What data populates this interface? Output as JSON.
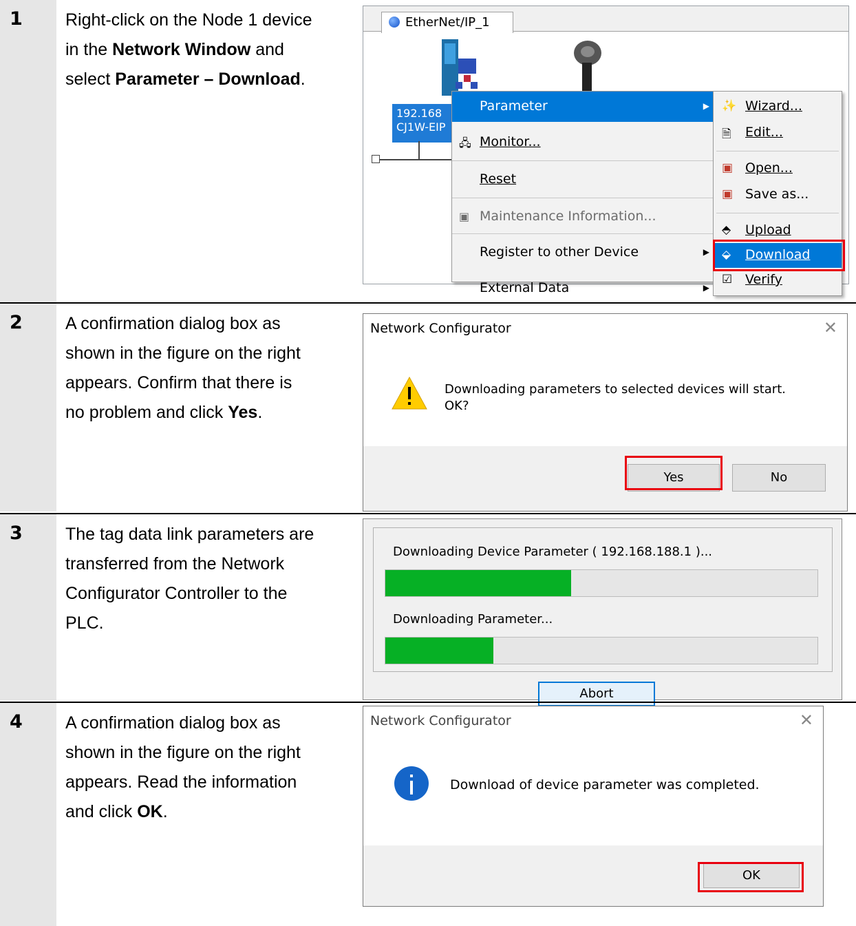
{
  "steps": [
    {
      "number": "1",
      "lines": [
        [
          {
            "t": "Right-click on the Node 1 device",
            "b": false
          }
        ],
        [
          {
            "t": "in the ",
            "b": false
          },
          {
            "t": "Network Window",
            "b": true
          },
          {
            "t": " and",
            "b": false
          }
        ],
        [
          {
            "t": "select ",
            "b": false
          },
          {
            "t": "Parameter – Download",
            "b": true
          },
          {
            "t": ".",
            "b": false
          }
        ]
      ]
    },
    {
      "number": "2",
      "lines": [
        [
          {
            "t": "A confirmation dialog box as",
            "b": false
          }
        ],
        [
          {
            "t": "shown in the figure on the right",
            "b": false
          }
        ],
        [
          {
            "t": "appears. Confirm that there is",
            "b": false
          }
        ],
        [
          {
            "t": "no problem and click ",
            "b": false
          },
          {
            "t": "Yes",
            "b": true
          },
          {
            "t": ".",
            "b": false
          }
        ]
      ]
    },
    {
      "number": "3",
      "lines": [
        [
          {
            "t": "The tag data link parameters are",
            "b": false
          }
        ],
        [
          {
            "t": "transferred from the Network",
            "b": false
          }
        ],
        [
          {
            "t": "Configurator Controller to the",
            "b": false
          }
        ],
        [
          {
            "t": "PLC.",
            "b": false
          }
        ]
      ]
    },
    {
      "number": "4",
      "lines": [
        [
          {
            "t": "A confirmation dialog box as",
            "b": false
          }
        ],
        [
          {
            "t": "shown in the figure on the right",
            "b": false
          }
        ],
        [
          {
            "t": "appears. Read the information",
            "b": false
          }
        ],
        [
          {
            "t": "and click ",
            "b": false
          },
          {
            "t": "OK",
            "b": true
          },
          {
            "t": ".",
            "b": false
          }
        ]
      ]
    }
  ],
  "network_window": {
    "tab": "EtherNet/IP_1",
    "device_label_line1": "192.168",
    "device_label_line2": "CJ1W-EIP"
  },
  "context_menu": {
    "parameter": "Parameter",
    "monitor": "Monitor...",
    "reset": "Reset",
    "maintenance": "Maintenance Information...",
    "register": "Register to other Device",
    "external": "External Data"
  },
  "submenu": {
    "wizard": "Wizard...",
    "edit": "Edit...",
    "open": "Open...",
    "save_as": "Save as...",
    "upload": "Upload",
    "download": "Download",
    "verify": "Verify"
  },
  "dialog_confirm": {
    "title": "Network Configurator",
    "message_line1": "Downloading parameters to selected devices will start.",
    "message_line2": "OK?",
    "yes": "Yes",
    "no": "No"
  },
  "progress_dialog": {
    "device_text": "Downloading Device Parameter ( 192.168.188.1 )...",
    "device_progress": 0.43,
    "param_text": "Downloading Parameter...",
    "param_progress": 0.25,
    "abort": "Abort"
  },
  "dialog_done": {
    "title": "Network Configurator",
    "message": "Download of device parameter was completed.",
    "ok": "OK"
  },
  "colors": {
    "selection": "#0078d7",
    "highlight_red": "#e8000e",
    "progress_green": "#06b025",
    "step_column": "#e6e6e6"
  }
}
